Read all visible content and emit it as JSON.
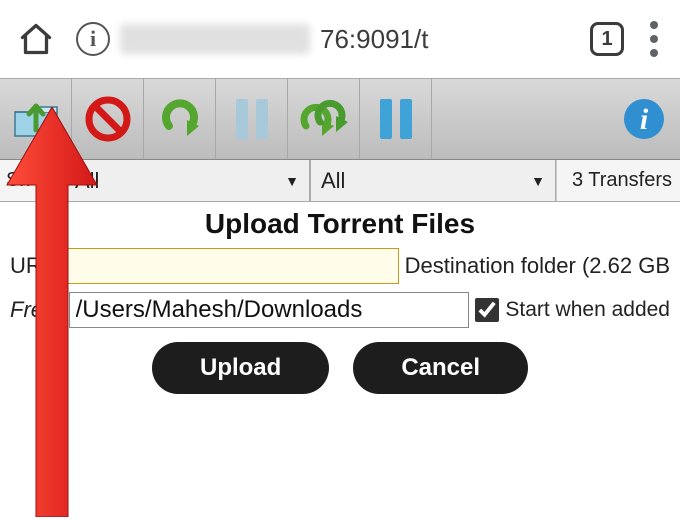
{
  "browser": {
    "url_visible_suffix": "76:9091/t",
    "tab_count": "1"
  },
  "filters": {
    "show_label_truncated": "Sh",
    "filter1": "All",
    "filter2": "All",
    "transfer_count": "3 Transfers"
  },
  "dialog": {
    "title": "Upload Torrent Files",
    "url_label": "URL",
    "url_value": "",
    "dest_label_prefix": "Destination folder ",
    "dest_size": "(2.62 GB",
    "free_label_suffix": "Fre.):",
    "folder_path": "/Users/Mahesh/Downloads",
    "start_when_added_label": "Start when added",
    "start_when_added_checked": true,
    "upload_btn": "Upload",
    "cancel_btn": "Cancel"
  }
}
